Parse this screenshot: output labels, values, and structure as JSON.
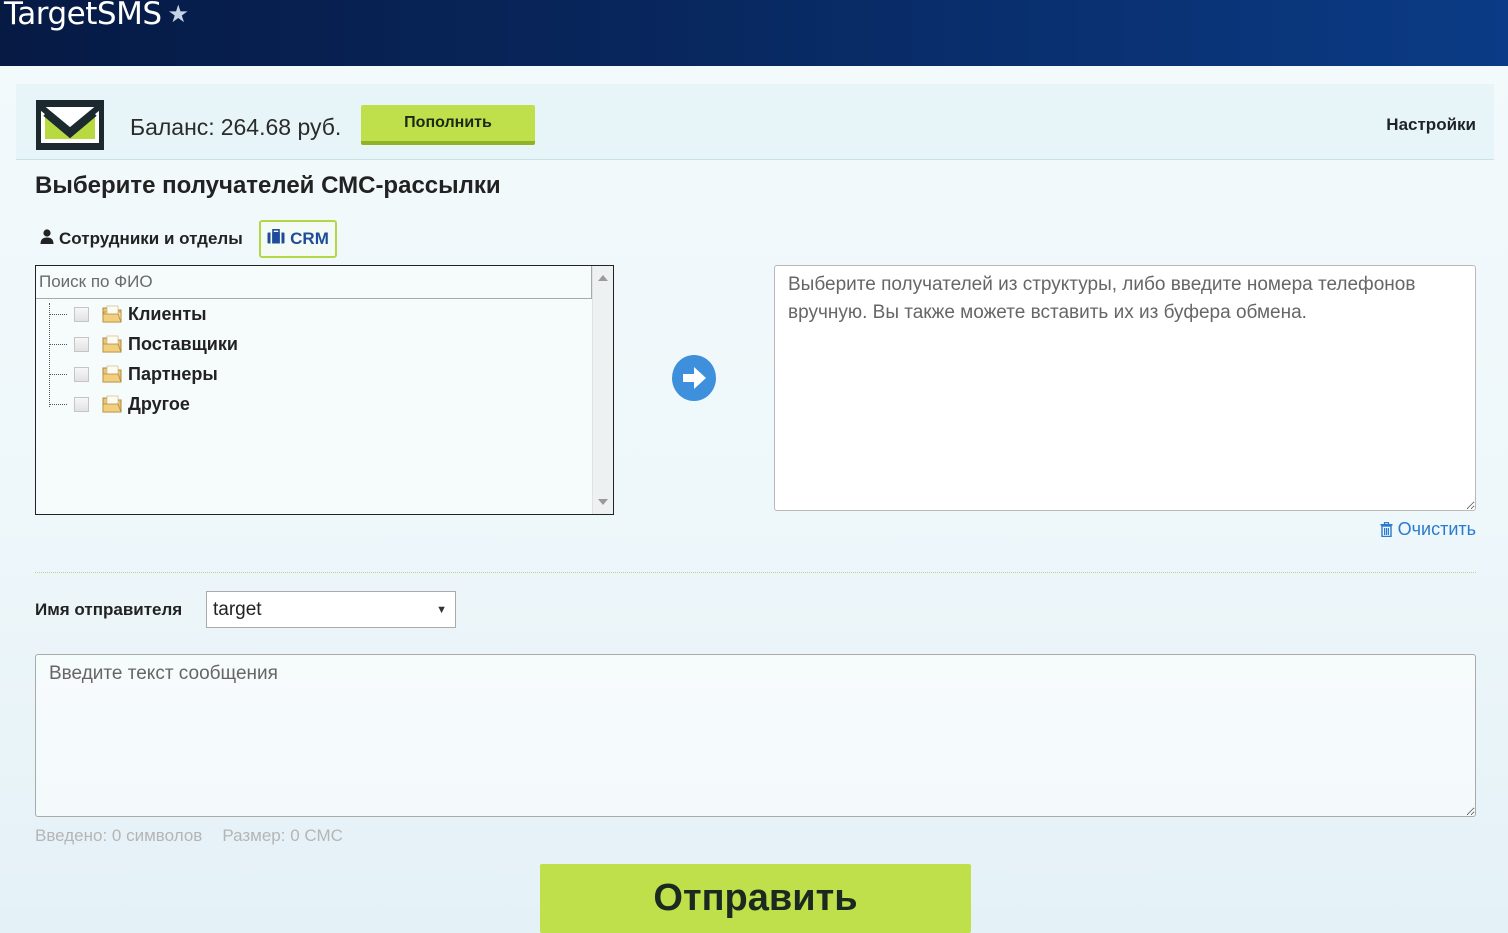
{
  "app": {
    "title": "TargetSMS",
    "star": "★"
  },
  "header": {
    "balance_label": "Баланс:",
    "balance_value": "264.68 руб.",
    "topup_label": "Пополнить",
    "settings_label": "Настройки"
  },
  "main": {
    "heading": "Выберите получателей СМС-рассылки",
    "tabs": [
      {
        "label": "Сотрудники и отделы",
        "icon": "user-icon",
        "active": false
      },
      {
        "label": "CRM",
        "icon": "briefcase-icon",
        "active": true
      }
    ],
    "tree": {
      "search_placeholder": "Поиск по ФИО",
      "items": [
        {
          "label": "Клиенты",
          "checked": false
        },
        {
          "label": "Поставщики",
          "checked": false
        },
        {
          "label": "Партнеры",
          "checked": false
        },
        {
          "label": "Другое",
          "checked": false
        }
      ]
    },
    "recipients_placeholder": "Выберите получателей из структуры, либо введите номера телефонов вручную. Вы также можете вставить их из буфера обмена.",
    "clear_label": "Очистить"
  },
  "compose": {
    "sender_label": "Имя отправителя",
    "sender_value": "target",
    "message_placeholder": "Введите текст сообщения",
    "typed_label": "Введено: 0 символов",
    "size_label": "Размер: 0 СМС",
    "send_label": "Отправить"
  },
  "colors": {
    "topbar": "#08275e",
    "accent_green": "#bfe04a",
    "link_blue": "#2a7ad0",
    "arrow_blue": "#3e8fdc"
  }
}
